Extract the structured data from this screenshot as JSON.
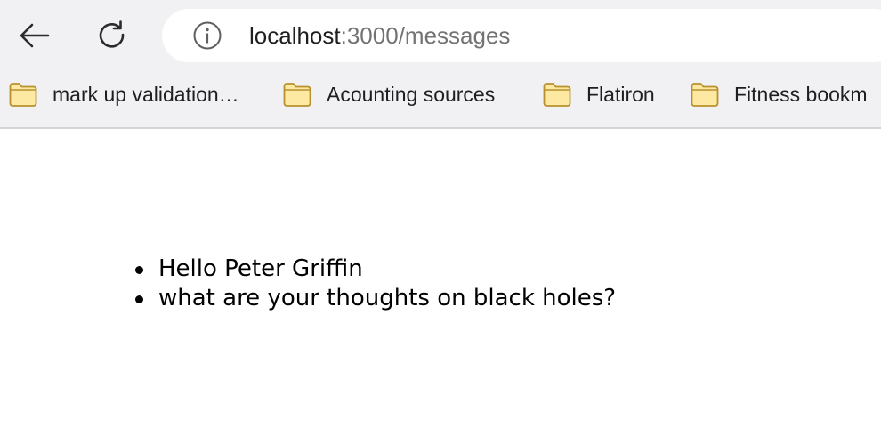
{
  "address_bar": {
    "url_host": "localhost",
    "url_rest": ":3000/messages"
  },
  "bookmarks": [
    {
      "label": "mark up validation…"
    },
    {
      "label": "Acounting sources"
    },
    {
      "label": "Flatiron"
    },
    {
      "label": "Fitness bookm"
    }
  ],
  "messages": [
    {
      "text": "Hello Peter Griffin"
    },
    {
      "text": "what are your thoughts on black holes?"
    }
  ],
  "icons": {
    "back": "back-arrow-icon",
    "reload": "reload-icon",
    "info": "info-icon",
    "folder": "folder-icon"
  },
  "colors": {
    "folder_fill": "#fde9a2",
    "folder_stroke": "#b8912e",
    "chrome_bg": "#f1f1f3"
  }
}
